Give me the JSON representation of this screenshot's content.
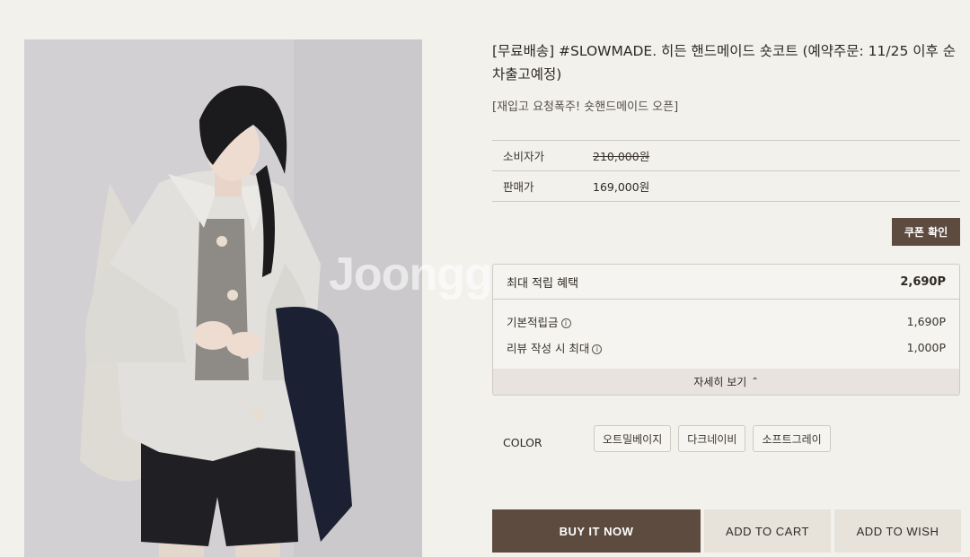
{
  "product": {
    "title": "[무료배송] #SLOWMADE. 히든 핸드메이드 숏코트 (예약주문: 11/25 이후 순차출고예정)",
    "subtitle": "[재입고 요청폭주! 숏핸드메이드 오픈]"
  },
  "watermark": "Joonggonara",
  "prices": {
    "consumer_label": "소비자가",
    "consumer_value": "210,000원",
    "sale_label": "판매가",
    "sale_value": "169,000원"
  },
  "coupon_button": "쿠폰 확인",
  "points": {
    "header_label": "최대 적립 혜택",
    "header_total": "2,690P",
    "basic_label": "기본적립금",
    "basic_value": "1,690P",
    "review_label": "리뷰 작성 시 최대",
    "review_value": "1,000P",
    "details_label": "자세히 보기",
    "info_icon": "i"
  },
  "color": {
    "label": "COLOR",
    "options": [
      "오트밀베이지",
      "다크네이비",
      "소프트그레이"
    ]
  },
  "actions": {
    "buy": "BUY IT NOW",
    "cart": "ADD TO CART",
    "wish": "ADD TO WISH"
  },
  "colors": {
    "accent_brown": "#5c4b3e",
    "background": "#f3f1ec",
    "light_button": "#e7e2da"
  }
}
